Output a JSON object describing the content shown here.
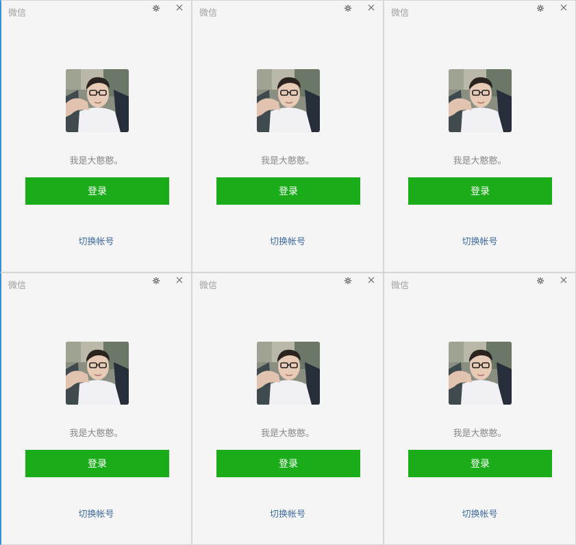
{
  "windows": [
    {
      "title": "微信",
      "username": "我是大憨憨。",
      "login_label": "登录",
      "switch_label": "切换帐号"
    },
    {
      "title": "微信",
      "username": "我是大憨憨。",
      "login_label": "登录",
      "switch_label": "切换帐号"
    },
    {
      "title": "微信",
      "username": "我是大憨憨。",
      "login_label": "登录",
      "switch_label": "切换帐号"
    },
    {
      "title": "微信",
      "username": "我是大憨憨。",
      "login_label": "登录",
      "switch_label": "切换帐号"
    },
    {
      "title": "微信",
      "username": "我是大憨憨。",
      "login_label": "登录",
      "switch_label": "切换帐号"
    },
    {
      "title": "微信",
      "username": "我是大憨憨。",
      "login_label": "登录",
      "switch_label": "切换帐号"
    }
  ],
  "icons": {
    "settings": "gear-icon",
    "close": "close-icon",
    "avatar": "avatar-photo"
  },
  "colors": {
    "login_button": "#1aad19",
    "switch_link": "#3f6c9e",
    "window_bg": "#f5f5f5",
    "title_text": "#a0a0a0"
  }
}
